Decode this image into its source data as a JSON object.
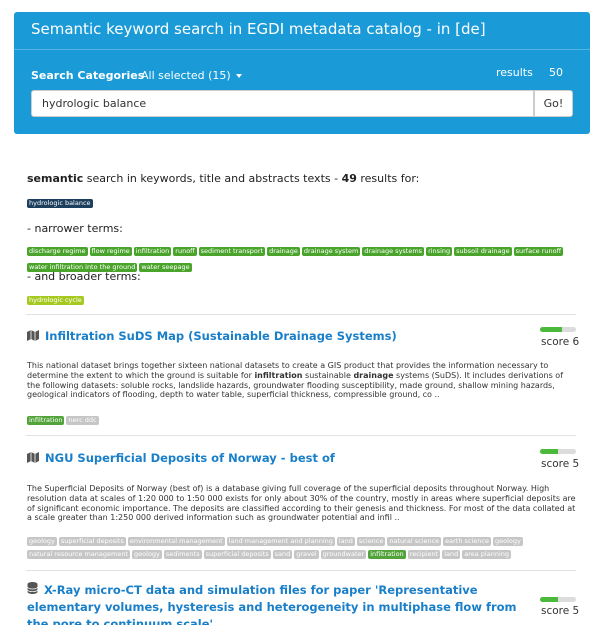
{
  "header": {
    "title": "Semantic keyword search in EGDI metadata catalog - in [de]",
    "categories_label": "Search Categories",
    "categories_value": "All selected (15)",
    "results_label": "results",
    "results_count": "50",
    "search_value": "hydrologic balance",
    "go_label": "Go!"
  },
  "summary": {
    "prefix": "semantic",
    "middle": " search in keywords, title and abstracts texts - ",
    "count": "49",
    "suffix": " results for:",
    "query_tag": "hydrologic balance"
  },
  "narrower": {
    "label": "- narrower terms:",
    "terms_row1": [
      "discharge regime",
      "flow regime",
      "infiltration",
      "runoff",
      "sediment transport",
      "drainage",
      "drainage system",
      "drainage systems",
      "rinsing",
      "subsoil drainage",
      "surface runoff"
    ],
    "terms_row2": [
      "water infiltration into the ground",
      "water seepage"
    ]
  },
  "broader": {
    "label": "- and broader terms:",
    "terms": [
      "hydrologic cycle"
    ]
  },
  "results": [
    {
      "title": "Infiltration SuDS Map (Sustainable Drainage Systems)",
      "score_label": "score 6",
      "score": 6,
      "desc_parts": [
        "This national dataset brings together sixteen national datasets to create a GIS product that provides the information necessary to determine the extent to which the ground is suitable for ",
        "infiltration",
        " sustainable ",
        "drainage",
        " systems (SuDS). It includes derivations of the following datasets: soluble rocks, landslide hazards, groundwater flooding susceptibility, made ground, shallow mining hazards, geological indicators of flooding, depth to water table, superficial thickness, compressible ground, co .."
      ],
      "tags": [
        {
          "label": "infiltration",
          "kind": "green"
        },
        {
          "label": "nerc ddc",
          "kind": "grey"
        }
      ]
    },
    {
      "title": "NGU Superficial Deposits of Norway - best of",
      "score_label": "score 5",
      "score": 5,
      "desc": "The Superficial Deposits of Norway (best of) is a database giving full coverage of the superficial deposits throughout Norway. High resolution data at scales of 1:20 000 to 1:50 000 exists for only about 30% of the country, mostly in areas where superficial deposits are of significant economic importance. The deposits are classified according to their genesis and thickness. For most of the data collated at a scale greater than 1:250 000 derived information such as groundwater potential and infil ..",
      "tags": [
        {
          "label": "geology",
          "kind": "grey"
        },
        {
          "label": "superficial deposits",
          "kind": "grey"
        },
        {
          "label": "environmental management",
          "kind": "grey"
        },
        {
          "label": "land management and planning",
          "kind": "grey"
        },
        {
          "label": "land",
          "kind": "grey"
        },
        {
          "label": "science",
          "kind": "grey"
        },
        {
          "label": "natural science",
          "kind": "grey"
        },
        {
          "label": "earth science",
          "kind": "grey"
        },
        {
          "label": "geology",
          "kind": "grey"
        },
        {
          "label": "natural resource management",
          "kind": "grey"
        },
        {
          "label": "geology",
          "kind": "grey"
        },
        {
          "label": "sediments",
          "kind": "grey"
        },
        {
          "label": "superficial deposits",
          "kind": "grey"
        },
        {
          "label": "sand",
          "kind": "grey"
        },
        {
          "label": "gravel",
          "kind": "grey"
        },
        {
          "label": "groundwater",
          "kind": "grey"
        },
        {
          "label": "infiltration",
          "kind": "green"
        },
        {
          "label": "recipient",
          "kind": "grey"
        },
        {
          "label": "land",
          "kind": "grey"
        },
        {
          "label": "area planning",
          "kind": "grey"
        }
      ]
    },
    {
      "title": "X-Ray micro-CT data and simulation files for paper 'Representative elementary volumes, hysteresis and heterogeneity in multiphase flow from the pore to continuum scale'",
      "score_label": "score 5",
      "score": 5
    }
  ],
  "colors": {
    "header_bg": "#1a9bd7",
    "link": "#1a7fc9",
    "tag_dark": "#1c3f5e",
    "tag_green": "#4aa42c",
    "tag_lime": "#a6c920",
    "tag_grey": "#c6c6c6",
    "score_fill": "#4ab93c"
  },
  "icons": {
    "result_map": "map-icon",
    "result_data": "database-icon"
  }
}
